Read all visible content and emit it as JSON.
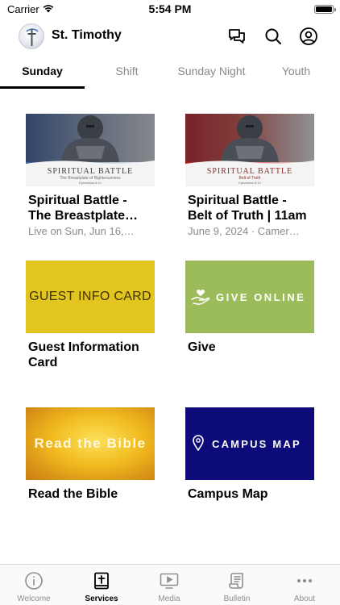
{
  "status_bar": {
    "carrier": "Carrier",
    "time": "5:54 PM"
  },
  "header": {
    "church_name": "St. Timothy",
    "icons": {
      "chat": "chat-bubbles-icon",
      "search": "search-icon",
      "profile": "profile-icon"
    }
  },
  "tabs": [
    {
      "label": "Sunday",
      "active": true
    },
    {
      "label": "Shift",
      "active": false
    },
    {
      "label": "Sunday Night",
      "active": false
    },
    {
      "label": "Youth",
      "active": false
    }
  ],
  "cards": [
    {
      "title_line1": "Spiritual Battle -",
      "title_line2": "The Breastplate…",
      "subtitle": "Live on Sun, Jun 16,…",
      "image_title": "SPIRITUAL BATTLE",
      "image_subtitle": "The Breastplate of Righteousness",
      "image_ref": "Ephesians 6:14"
    },
    {
      "title_line1": "Spiritual Battle -",
      "title_line2": "Belt of Truth | 11am",
      "subtitle": "June 9, 2024 · Camer…",
      "image_title": "SPIRITUAL BATTLE",
      "image_subtitle": "Belt of Truth",
      "image_ref": "Ephesians 6:14"
    },
    {
      "title_line1": "Guest Information",
      "title_line2": "Card",
      "image_text": "GUEST INFO CARD",
      "image_color": "#e3c51f"
    },
    {
      "title_line1": "Give",
      "image_text": "GIVE ONLINE",
      "image_color": "#9cbc5b"
    },
    {
      "title_line1": "Read the Bible",
      "image_text": "Read the Bible",
      "image_color": "#e0a418"
    },
    {
      "title_line1": "Campus Map",
      "image_text": "CAMPUS MAP",
      "image_color": "#0d0a7a"
    }
  ],
  "bottom_nav": [
    {
      "label": "Welcome",
      "icon": "info-circle-icon",
      "active": false
    },
    {
      "label": "Services",
      "icon": "bible-cross-icon",
      "active": true
    },
    {
      "label": "Media",
      "icon": "play-screen-icon",
      "active": false
    },
    {
      "label": "Bulletin",
      "icon": "scroll-icon",
      "active": false
    },
    {
      "label": "About",
      "icon": "more-dots-icon",
      "active": false
    }
  ]
}
